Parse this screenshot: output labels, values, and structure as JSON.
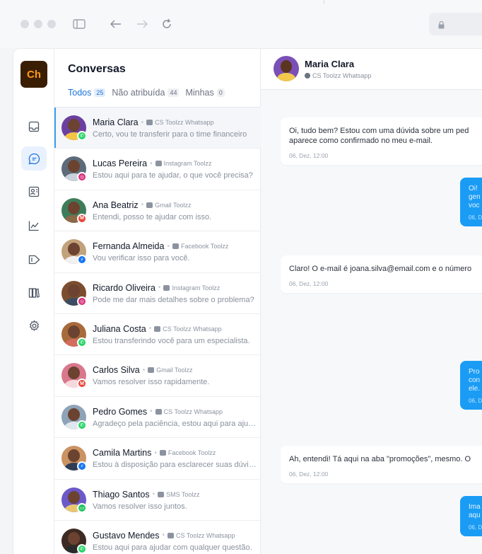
{
  "app": {
    "logo": "Ch"
  },
  "list": {
    "title": "Conversas",
    "tabs": [
      {
        "label": "Todos",
        "count": "25"
      },
      {
        "label": "Não atribuída",
        "count": "44"
      },
      {
        "label": "Minhas",
        "count": "0"
      }
    ],
    "conversations": [
      {
        "name": "Maria Clara",
        "channel": "CS Toolzz Whatsapp",
        "channel_type": "whatsapp",
        "preview": "Certo, vou te transferir para o time financeiro"
      },
      {
        "name": "Lucas Pereira",
        "channel": "Instagram Toolzz",
        "channel_type": "instagram",
        "preview": "Estou aqui para te ajudar, o que você precisa?"
      },
      {
        "name": "Ana Beatriz",
        "channel": "Gmail Toolzz",
        "channel_type": "gmail",
        "preview": "Entendi, posso te ajudar com isso."
      },
      {
        "name": "Fernanda Almeida",
        "channel": "Facebook Toolzz",
        "channel_type": "messenger",
        "preview": "Vou verificar isso para você."
      },
      {
        "name": "Ricardo Oliveira",
        "channel": "Instagram Toolzz",
        "channel_type": "instagram",
        "preview": "Pode me dar mais detalhes sobre o problema?"
      },
      {
        "name": "Juliana Costa",
        "channel": "CS Toolzz Whatsapp",
        "channel_type": "whatsapp",
        "preview": "Estou transferindo você para um especialista."
      },
      {
        "name": "Carlos Silva",
        "channel": "Gmail Toolzz",
        "channel_type": "gmail",
        "preview": "Vamos resolver isso rapidamente."
      },
      {
        "name": "Pedro Gomes",
        "channel": "CS Toolzz Whatsapp",
        "channel_type": "whatsapp",
        "preview": "Agradeço pela paciência, estou aqui para ajudar."
      },
      {
        "name": "Camila Martins",
        "channel": "Facebook Toolzz",
        "channel_type": "messenger",
        "preview": "Estou à disposição para esclarecer suas dúvidas."
      },
      {
        "name": "Thiago Santos",
        "channel": "SMS Toolzz",
        "channel_type": "sms",
        "preview": "Vamos resolver isso juntos."
      },
      {
        "name": "Gustavo Mendes",
        "channel": "CS Toolzz Whatsapp",
        "channel_type": "whatsapp",
        "preview": "Estou aqui para ajudar com qualquer questão."
      }
    ]
  },
  "chat": {
    "name": "Maria Clara",
    "channel": "CS Toolzz Whatsapp",
    "messages": [
      {
        "direction": "in",
        "lines": [
          "Oi, tudo bem? Estou com uma dúvida sobre um ped",
          "aparece como confirmado no meu e-mail."
        ],
        "time": "06, Dez, 12:00"
      },
      {
        "direction": "out",
        "lines": [
          "Oi!",
          "gen",
          "voc"
        ],
        "time": "06, D"
      },
      {
        "direction": "in",
        "lines": [
          "Claro! O e-mail é joana.silva@email.com e o número"
        ],
        "time": "06, Dez, 12:00"
      },
      {
        "direction": "out",
        "lines": [
          "Pro",
          "con",
          "ele."
        ],
        "time": "06, D"
      },
      {
        "direction": "in",
        "lines": [
          "Ah, entendi! Tá aqui na aba \"promoções\", mesmo. O"
        ],
        "time": "06, Dez, 12:00"
      },
      {
        "direction": "out",
        "lines": [
          "Ima",
          "aqu"
        ],
        "time": "06, D"
      }
    ]
  },
  "colors": {
    "accent": "#1d74d8",
    "outgoing_bubble": "#1a9cf5",
    "logo_bg": "#3a1e04",
    "logo_text": "#ff9a18",
    "whatsapp": "#25d366",
    "instagram": "#d62976",
    "gmail": "#ea4335",
    "messenger": "#1877f2",
    "sms": "#22c55e"
  }
}
